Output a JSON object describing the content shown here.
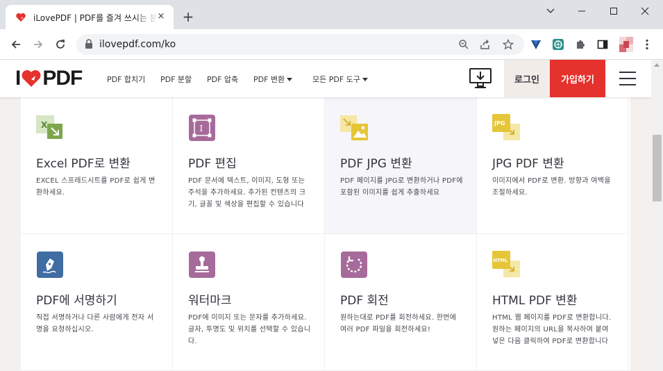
{
  "browser": {
    "tab_title": "iLovePDF | PDF를 즐겨 쓰시는 분들을",
    "tab_close": "×",
    "new_tab": "+",
    "url": "ilovepdf.com/ko"
  },
  "site": {
    "logo": {
      "letter_i": "I",
      "letters": "PDF"
    },
    "nav": [
      {
        "label": "PDF 합치기"
      },
      {
        "label": "PDF 분할"
      },
      {
        "label": "PDF 압축"
      },
      {
        "label": "PDF 변환",
        "dropdown": true
      },
      {
        "label": "모든 PDF 도구",
        "dropdown": true
      }
    ],
    "login": "로그인",
    "signup": "가입하기"
  },
  "tools": [
    {
      "title": "Excel PDF로 변환",
      "desc": "EXCEL 스프레드시트를 PDF로 쉽게 변환하세요.",
      "icon": "excel-to-pdf-icon",
      "color": "#7fa64d"
    },
    {
      "title": "PDF 편집",
      "desc": "PDF 문서에 텍스트, 이미지, 도형 또는 주석을 추가하세요. 추가된 컨텐츠의 크기, 글꼴 및 색상을 편집할 수 있습니다",
      "icon": "edit-pdf-icon",
      "color": "#a66b9a"
    },
    {
      "title": "PDF JPG 변환",
      "desc": "PDF 페이지를 JPG로 변환하거나 PDF에 포함된 이미지를 쉽게 추출하세요",
      "icon": "pdf-to-jpg-icon",
      "color": "#e5c637"
    },
    {
      "title": "JPG PDF 변환",
      "desc": "이미지에서 PDF로 변환. 방향과 여백을 조절하세요.",
      "icon": "jpg-to-pdf-icon",
      "color": "#e5c637"
    },
    {
      "title": "PDF에 서명하기",
      "desc": "직접 서명하거나 다른 사람에게 전자 서명을 요청하십시오.",
      "icon": "sign-pdf-icon",
      "color": "#3f6da3"
    },
    {
      "title": "워터마크",
      "desc": "PDF에 이미지 또는 문자를 추가하세요. 글자, 투명도 및 위치를 선택할 수 있습니다.",
      "icon": "watermark-icon",
      "color": "#a66b9a"
    },
    {
      "title": "PDF 회전",
      "desc": "원하는대로 PDF를 회전하세요. 한번에 여러 PDF 파일을 회전하세요!",
      "icon": "rotate-pdf-icon",
      "color": "#a66b9a"
    },
    {
      "title": "HTML PDF 변환",
      "desc": "HTML 웹 페이지를 PDF로 변환합니다. 원하는 페이지의 URL을 복사하여 붙여 넣은 다음 클릭하여 PDF로 변환합니다",
      "icon": "html-to-pdf-icon",
      "color": "#e5c637"
    }
  ],
  "icon_text": {
    "excel": "X",
    "jpg": "JPG",
    "html": "HTML",
    "edit": "I"
  },
  "colors": {
    "brand_red": "#e5322d",
    "text": "#33333b"
  }
}
